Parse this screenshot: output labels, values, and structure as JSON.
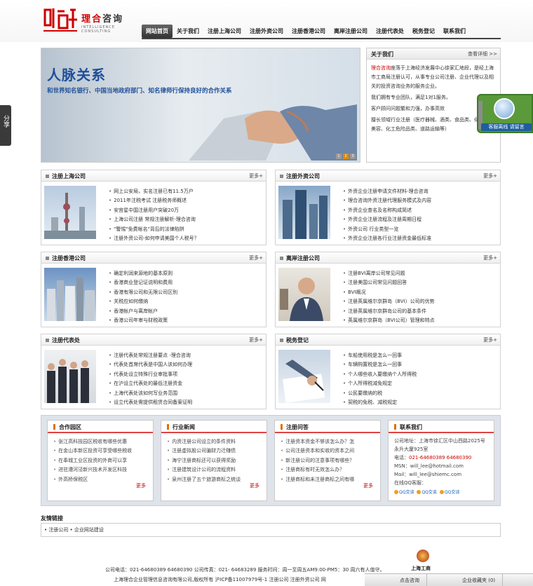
{
  "header": {
    "logo_cn_red": "理合",
    "logo_cn_dark": "咨询",
    "logo_en": "INTELLIGENCE CONSULTING",
    "nav": [
      "网站首页",
      "关于我们",
      "注册上海公司",
      "注册外资公司",
      "注册香港公司",
      "离岸注册公司",
      "注册代表处",
      "税务登记",
      "联系我们"
    ],
    "active_nav": "网站首页"
  },
  "share": {
    "label": "分享"
  },
  "banner": {
    "title": "人脉关系",
    "subtitle": "和世界知名银行、中国当地政府部门、知名律师行保持良好的合作关系",
    "dots": [
      "1",
      "2",
      "3"
    ]
  },
  "about": {
    "title": "关于我们",
    "more": "查看详细 >>",
    "brand": "理合咨询",
    "p1_rest": "座落于上海经济发展中心徐家汇地段，是经上海市工商局注册认可，从事专业公司注册、企业代理以及相关的投资咨询业务的服务企业。",
    "p2": "我们拥有专业团队，满足1对1服务。",
    "p3": "客户顾问问题繁和力强，办事高效",
    "p4": "擅长领域行业注册（医疗器械、酒类、食品类、化妆品、美容、化工危险品类、道路运输等）"
  },
  "service": {
    "label": "客服离线 请留言",
    "powered": "Powered by 53KF"
  },
  "panels": [
    {
      "title": "注册上海公司",
      "more": "更多+",
      "items": [
        "网上公安局，实名注册已有11.5万户",
        "2011年注税考试 注册税务师概述",
        "安宫星中国注册用户突破20万",
        "上海公司注册 常规注册解析-理合咨询",
        "\"警惕\"免费帐名\"背后的法律陷阱",
        "注册外资公司-如何申请美国个人税号？"
      ]
    },
    {
      "title": "注册外资公司",
      "more": "更多+",
      "items": [
        "外资企业注册申请文件材料-理合咨询",
        "理合咨询外资注册代理服务模式及内容",
        "外资企业查名及名称构成简述",
        "外资企业注册流程及注册周期日程",
        "外资公司 行业类型一览",
        "外资企业注册各行业注册资金最低标准"
      ]
    },
    {
      "title": "注册香港公司",
      "more": "更多+",
      "items": [
        "确定利润来源地的基本原则",
        "香港商业登记证说明和费用",
        "香港有限公司和无限公司区别",
        "关税应如何缴纳",
        "香港帐户与离岸帐户",
        "香港公司年审与财税政策"
      ]
    },
    {
      "title": "离岸注册公司",
      "more": "更多+",
      "items": [
        "注册BVI离岸公司常见问题",
        "注册美国公司常见问题回答",
        "BVI概况",
        "注册英属维尔京群岛（BVI）公司的优势",
        "注册英属维尔京群岛公司的基本条件",
        "英属维尔京群岛（BVI公司）管理和特点"
      ]
    },
    {
      "title": "注册代表处",
      "more": "更多+",
      "items": [
        "注册代表处常规注册要点 -理合咨询",
        "代表处首席代表是中国人该如何办理",
        "代表处设立特殊行业审批事项",
        "在沪设立代表处的最低注册资金",
        "上海代表处该如何写业务范围",
        "设立代表处需提供租赁合同备案证明"
      ]
    },
    {
      "title": "税务登记",
      "more": "更多+",
      "items": [
        "车船使用税是怎么一回事",
        "车辆购置税是怎么一回事",
        "个人哪些收入要缴纳个人所得税",
        "个人所得税减免规定",
        "公民要缴纳的税",
        "契税的免税、减税规定"
      ]
    }
  ],
  "bottom_tabs": [
    {
      "title": "合作园区",
      "more": "更多",
      "items": [
        "张江高科技园区税收有哪些优惠",
        "在金山本新区投资可享受哪些税收",
        "在奉城工业区投资的外商可以享",
        "进驻漕河泾新兴技术开发区科技",
        "外高桥保税区"
      ]
    },
    {
      "title": "行业新闻",
      "more": "更多",
      "items": [
        "内资注册公司设立的条件资料",
        "注册虚拟股公司骗财力迁赚债",
        "海宁注册商标还可以获得奖励",
        "注册建筑设计公司的流程资料",
        "泉州注册了五个旅游商标之统谈"
      ]
    },
    {
      "title": "注册问答",
      "more": "更多",
      "items": [
        "注册资本资金不够该怎么办？怎",
        "公司注册资本和实收的资本之间",
        "新注册公司的注意事项有哪些？",
        "注册商标有时无效怎么办？",
        "注册商标和未注册商标之间有哪"
      ]
    }
  ],
  "contact": {
    "title": "联系我们",
    "address": "公司地址：上海市徐汇区中山西路2025号永升大厦925室",
    "phone_label": "电话：",
    "phone": "021-64680389 64680390",
    "msn": "MSN：will_lee@hotmail.com",
    "mail": "Mail：will_lee@shiemc.com",
    "qq_label": "在线QQ客服：",
    "qq": [
      "QQ交谈",
      "QQ交谈",
      "QQ交谈"
    ]
  },
  "links": {
    "title": "友情链接",
    "items": "• 注册公司 • 企业网站建设"
  },
  "footer": {
    "row1": "公司电话：021-64680389 64680390 公司传真：021- 64683289 服务时间：周一至周五AM9:00-PM5：30 周六有人值守。",
    "row2": "上海理合企业管理信息咨询有限公司,版权所有  沪ICP备11007979号-1    注册公司 注册外资公司 网",
    "gov": "上海工商"
  },
  "bottom_bar": {
    "btn1": "点击咨询",
    "btn2": "企业收藏夹 (0)"
  }
}
